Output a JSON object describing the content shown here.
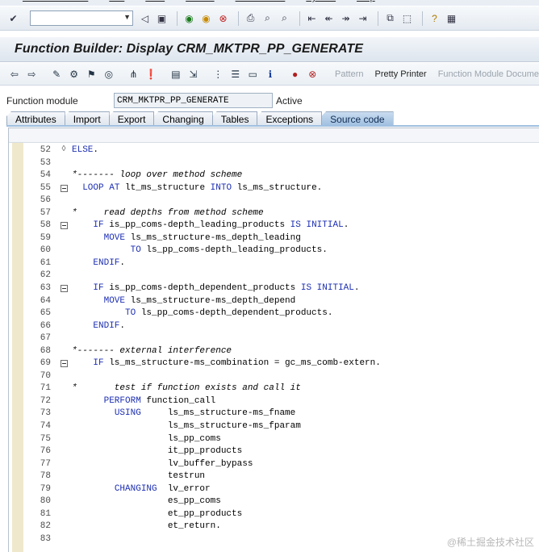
{
  "menu": [
    "Function Module",
    "Edit",
    "Goto",
    "Utilities",
    "Environment",
    "System",
    "Help"
  ],
  "title": "Function Builder: Display CRM_MKTPR_PP_GENERATE",
  "app_toolbar": {
    "pattern_label": "Pattern",
    "pretty_printer_label": "Pretty Printer",
    "fm_docu_label": "Function Module Docume"
  },
  "function_module": {
    "label": "Function module",
    "value": "CRM_MKTPR_PP_GENERATE",
    "status": "Active"
  },
  "tabs": [
    "Attributes",
    "Import",
    "Export",
    "Changing",
    "Tables",
    "Exceptions",
    "Source code"
  ],
  "active_tab": "Source code",
  "code_lines": [
    {
      "num": "52",
      "text": "ELSE.",
      "kind": "kw",
      "fold": "diamond"
    },
    {
      "num": "53",
      "text": "",
      "kind": "plain",
      "fold": ""
    },
    {
      "num": "54",
      "text": "*------- loop over method scheme",
      "kind": "cm",
      "fold": ""
    },
    {
      "num": "55",
      "text": "  LOOP AT lt_ms_structure INTO ls_ms_structure.",
      "kind": "mixed",
      "fold": "box"
    },
    {
      "num": "56",
      "text": "",
      "kind": "plain",
      "fold": ""
    },
    {
      "num": "57",
      "text": "*     read depths from method scheme",
      "kind": "cm",
      "fold": ""
    },
    {
      "num": "58",
      "text": "    IF is_pp_coms-depth_leading_products IS INITIAL.",
      "kind": "mixed",
      "fold": "box"
    },
    {
      "num": "59",
      "text": "      MOVE ls_ms_structure-ms_depth_leading",
      "kind": "mixed",
      "fold": ""
    },
    {
      "num": "60",
      "text": "           TO ls_pp_coms-depth_leading_products.",
      "kind": "mixed",
      "fold": ""
    },
    {
      "num": "61",
      "text": "    ENDIF.",
      "kind": "kw",
      "fold": ""
    },
    {
      "num": "62",
      "text": "",
      "kind": "plain",
      "fold": ""
    },
    {
      "num": "63",
      "text": "    IF is_pp_coms-depth_dependent_products IS INITIAL.",
      "kind": "mixed",
      "fold": "box"
    },
    {
      "num": "64",
      "text": "      MOVE ls_ms_structure-ms_depth_depend",
      "kind": "mixed",
      "fold": ""
    },
    {
      "num": "65",
      "text": "          TO ls_pp_coms-depth_dependent_products.",
      "kind": "mixed",
      "fold": ""
    },
    {
      "num": "66",
      "text": "    ENDIF.",
      "kind": "kw",
      "fold": ""
    },
    {
      "num": "67",
      "text": "",
      "kind": "plain",
      "fold": ""
    },
    {
      "num": "68",
      "text": "*------- external interference",
      "kind": "cm",
      "fold": ""
    },
    {
      "num": "69",
      "text": "    IF ls_ms_structure-ms_combination = gc_ms_comb-extern.",
      "kind": "mixed",
      "fold": "box"
    },
    {
      "num": "70",
      "text": "",
      "kind": "plain",
      "fold": ""
    },
    {
      "num": "71",
      "text": "*       test if function exists and call it",
      "kind": "cm",
      "fold": ""
    },
    {
      "num": "72",
      "text": "      PERFORM function_call",
      "kind": "mixed",
      "fold": ""
    },
    {
      "num": "73",
      "text": "        USING     ls_ms_structure-ms_fname",
      "kind": "mixed",
      "fold": ""
    },
    {
      "num": "74",
      "text": "                  ls_ms_structure-ms_fparam",
      "kind": "plain",
      "fold": ""
    },
    {
      "num": "75",
      "text": "                  ls_pp_coms",
      "kind": "plain",
      "fold": ""
    },
    {
      "num": "76",
      "text": "                  it_pp_products",
      "kind": "plain",
      "fold": ""
    },
    {
      "num": "77",
      "text": "                  lv_buffer_bypass",
      "kind": "plain",
      "fold": ""
    },
    {
      "num": "78",
      "text": "                  testrun",
      "kind": "plain",
      "fold": ""
    },
    {
      "num": "79",
      "text": "        CHANGING  lv_error",
      "kind": "mixed",
      "fold": ""
    },
    {
      "num": "80",
      "text": "                  es_pp_coms",
      "kind": "plain",
      "fold": ""
    },
    {
      "num": "81",
      "text": "                  et_pp_products",
      "kind": "plain",
      "fold": ""
    },
    {
      "num": "82",
      "text": "                  et_return.",
      "kind": "plain",
      "fold": ""
    },
    {
      "num": "83",
      "text": "",
      "kind": "plain",
      "fold": ""
    }
  ],
  "keywords": [
    "ELSE",
    "LOOP",
    "AT",
    "INTO",
    "IF",
    "IS",
    "INITIAL",
    "MOVE",
    "TO",
    "ENDIF",
    "PERFORM",
    "USING",
    "CHANGING"
  ],
  "watermark": "@稀土掘金技术社区",
  "colors": {
    "keyword": "#1d2fb2",
    "comment": "#8c8c8c",
    "active_tab": "#9fbfe0",
    "gutter": "#efe8cc"
  }
}
